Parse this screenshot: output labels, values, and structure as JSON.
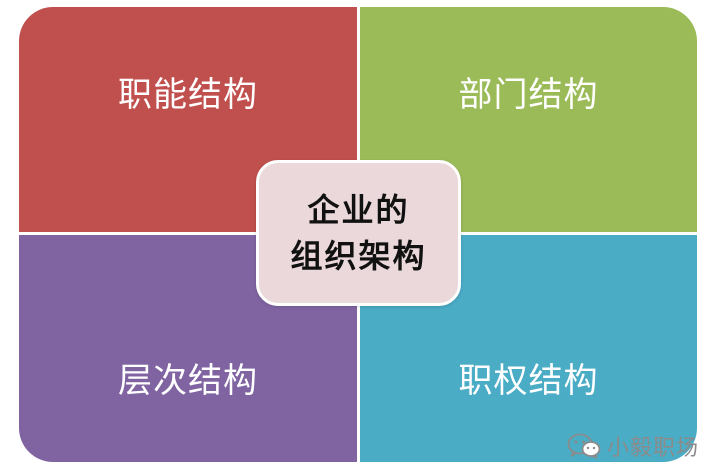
{
  "quadrants": [
    {
      "label": "职能结构",
      "color": "#c0504d"
    },
    {
      "label": "部门结构",
      "color": "#9bbb59"
    },
    {
      "label": "层次结构",
      "color": "#8064a2"
    },
    {
      "label": "职权结构",
      "color": "#4bacc6"
    }
  ],
  "center": {
    "line1": "企业的",
    "line2": "组织架构",
    "color": "#ead8da"
  },
  "watermark": {
    "text": "小毅职场",
    "icon": "wechat-icon"
  }
}
